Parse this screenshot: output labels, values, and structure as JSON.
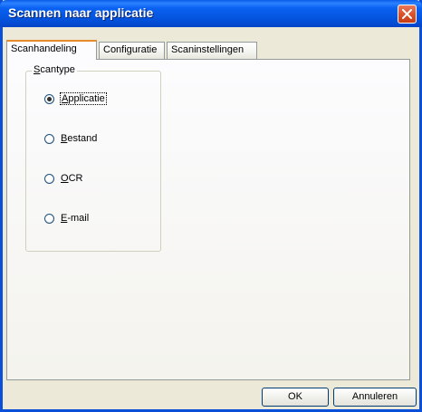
{
  "window": {
    "title": "Scannen naar applicatie"
  },
  "tabs": [
    {
      "label": "Scanhandeling",
      "active": true
    },
    {
      "label": "Configuratie",
      "active": false
    },
    {
      "label": "Scaninstellingen",
      "active": false
    }
  ],
  "scantype": {
    "legend_prefix": "S",
    "legend_rest": "cantype",
    "options": [
      {
        "mnemonic": "A",
        "rest": "pplicatie",
        "selected": true
      },
      {
        "mnemonic": "B",
        "rest": "estand",
        "selected": false
      },
      {
        "mnemonic": "O",
        "rest": "CR",
        "selected": false
      },
      {
        "mnemonic": "E",
        "rest": "-mail",
        "selected": false
      }
    ]
  },
  "buttons": {
    "ok": "OK",
    "cancel": "Annuleren"
  },
  "colors": {
    "titlebar": "#0a5be8",
    "close": "#d9532c",
    "active_tab_accent": "#e68b2c",
    "face": "#ece9d8"
  }
}
